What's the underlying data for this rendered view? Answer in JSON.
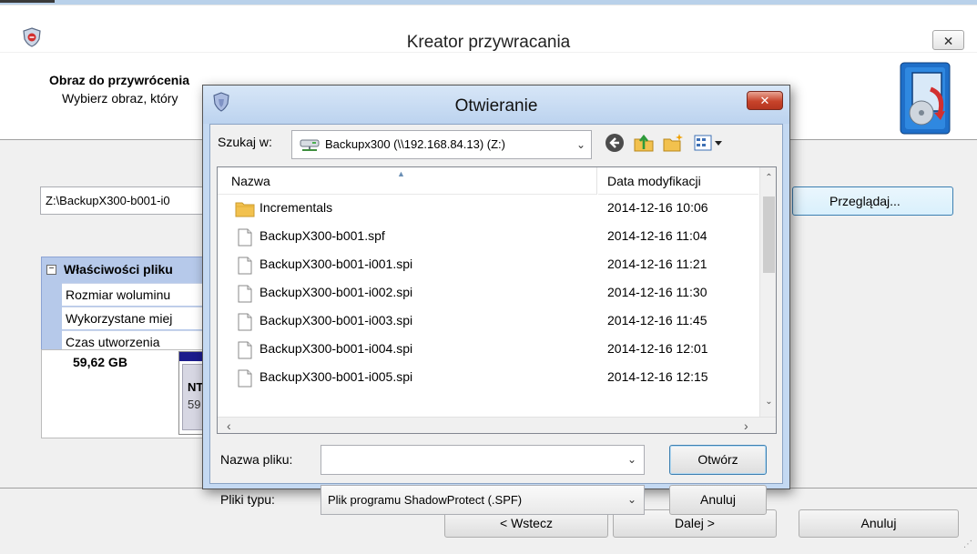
{
  "wizard": {
    "title": "Kreator przywracania",
    "close_glyph": "🗙",
    "heading": "Obraz do przywrócenia",
    "subheading": "Wybierz obraz, który",
    "path_value": "Z:\\BackupX300-b001-i0",
    "browse_label": "Przeglądaj...",
    "properties": {
      "header": "Właściwości pliku",
      "toggle": "−",
      "rows": [
        "Rozmiar woluminu",
        "Wykorzystane miej",
        "Czas utworzenia"
      ]
    },
    "volume": {
      "size": "59,62 GB",
      "partition_label": "NT",
      "partition_sub": "59"
    },
    "buttons": {
      "back": "< Wstecz",
      "next": "Dalej >",
      "cancel": "Anuluj"
    }
  },
  "dialog": {
    "title": "Otwieranie",
    "close_glyph": "✕",
    "look_in_label": "Szukaj w:",
    "look_in_value": "Backupx300 (\\\\192.168.84.13) (Z:)",
    "toolbar_icons": [
      "back-icon",
      "up-folder-icon",
      "new-folder-icon",
      "view-menu-icon"
    ],
    "columns": {
      "name": "Nazwa",
      "date": "Data modyfikacji"
    },
    "files": [
      {
        "name": "Incrementals",
        "date": "2014-12-16 10:06",
        "type": "folder"
      },
      {
        "name": "BackupX300-b001.spf",
        "date": "2014-12-16 11:04",
        "type": "file"
      },
      {
        "name": "BackupX300-b001-i001.spi",
        "date": "2014-12-16 11:21",
        "type": "file"
      },
      {
        "name": "BackupX300-b001-i002.spi",
        "date": "2014-12-16 11:30",
        "type": "file"
      },
      {
        "name": "BackupX300-b001-i003.spi",
        "date": "2014-12-16 11:45",
        "type": "file"
      },
      {
        "name": "BackupX300-b001-i004.spi",
        "date": "2014-12-16 12:01",
        "type": "file"
      },
      {
        "name": "BackupX300-b001-i005.spi",
        "date": "2014-12-16 12:15",
        "type": "file"
      }
    ],
    "filename_label": "Nazwa pliku:",
    "filename_value": "",
    "filetype_label": "Pliki typu:",
    "filetype_value": "Plik programu ShadowProtect (.SPF)",
    "open_label": "Otwórz",
    "cancel_label": "Anuluj"
  },
  "colors": {
    "dialog_frame": "#c4d9f2",
    "close_red": "#c7432a",
    "selection_blue": "#b6c9ea",
    "focus_blue": "#3c7fb1"
  }
}
